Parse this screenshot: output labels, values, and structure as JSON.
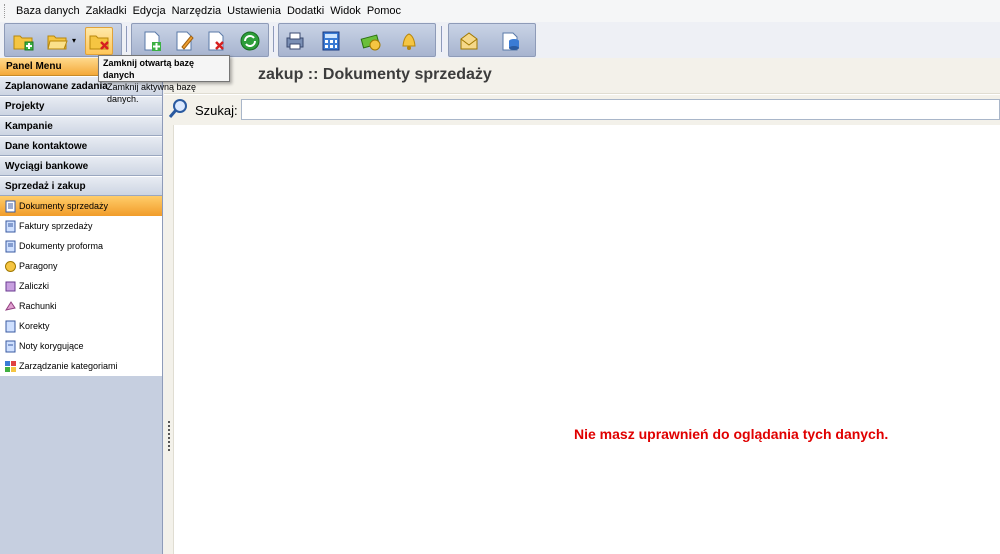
{
  "menu": [
    "Baza danych",
    "Zakładki",
    "Edycja",
    "Narzędzia",
    "Ustawienia",
    "Dodatki",
    "Widok",
    "Pomoc"
  ],
  "toolbar": {
    "buttons": [
      {
        "name": "new-database-icon"
      },
      {
        "name": "open-database-icon"
      },
      {
        "name": "close-database-icon"
      },
      {
        "name": "add-document-icon"
      },
      {
        "name": "edit-document-icon"
      },
      {
        "name": "delete-document-icon"
      },
      {
        "name": "refresh-icon"
      },
      {
        "name": "print-icon"
      },
      {
        "name": "calculator-icon"
      },
      {
        "name": "money-icon"
      },
      {
        "name": "bell-icon"
      },
      {
        "name": "mail-icon"
      },
      {
        "name": "database-icon"
      }
    ]
  },
  "tooltip": {
    "title": "Zamknij otwartą bazę danych",
    "text": "Zamknij aktywną bazę danych."
  },
  "sidebar": {
    "panel_title": "Panel Menu",
    "sections": [
      "Zaplanowane zadania",
      "Projekty",
      "Kampanie",
      "Dane kontaktowe",
      "Wyciągi bankowe",
      "Sprzedaż i zakup"
    ],
    "items": [
      {
        "label": "Dokumenty sprzedaży",
        "selected": true
      },
      {
        "label": "Faktury sprzedaży"
      },
      {
        "label": "Dokumenty proforma"
      },
      {
        "label": "Paragony"
      },
      {
        "label": "Zaliczki"
      },
      {
        "label": "Rachunki"
      },
      {
        "label": "Korekty"
      },
      {
        "label": "Noty korygujące"
      },
      {
        "label": "Zarządzanie kategoriami"
      }
    ]
  },
  "main": {
    "title": "zakup :: Dokumenty sprzedaży",
    "search_label": "Szukaj:",
    "search_value": "",
    "error": "Nie masz uprawnień do oglądania tych danych."
  },
  "colors": {
    "accent_orange": "#f19c2a",
    "error_red": "#e00000",
    "sidebar_bg": "#c6cfe0"
  }
}
